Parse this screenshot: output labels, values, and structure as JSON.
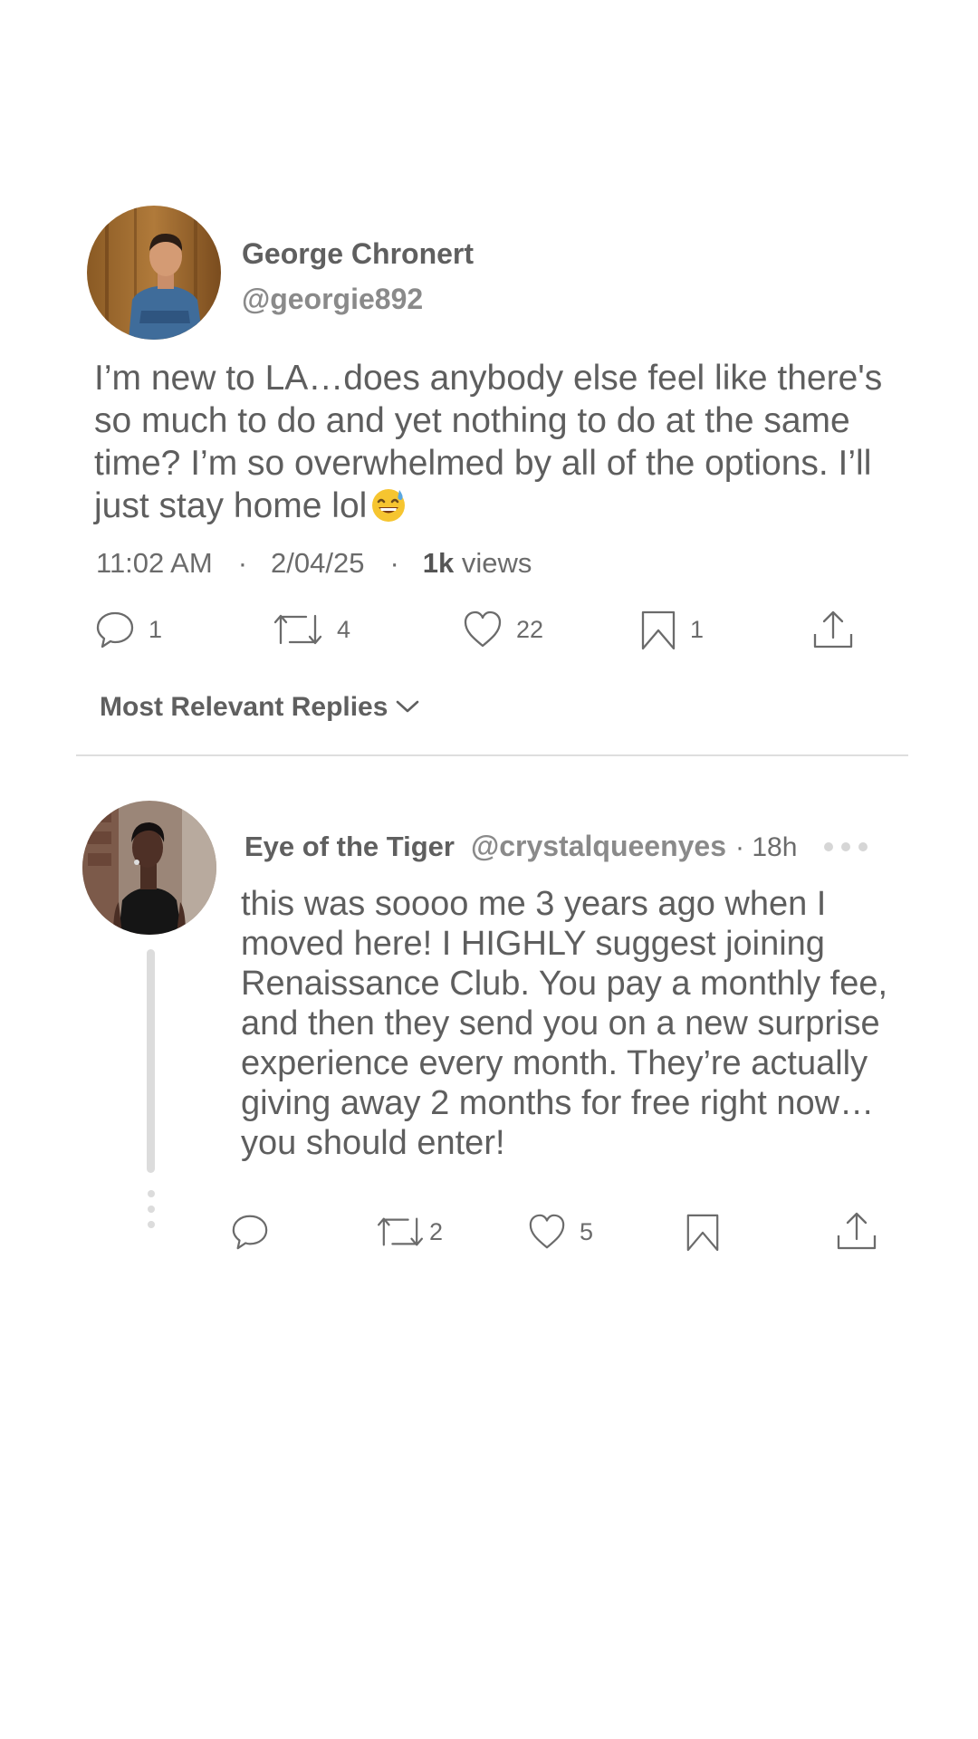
{
  "post": {
    "author_name": "George Chronert",
    "author_handle": "@georgie892",
    "avatar_icon": "user-avatar-photo",
    "text": "I’m new to LA…does anybody else feel like there's so much to do and yet nothing to do at the same time? I’m so overwhelmed by all of the options. I’ll just stay home lol",
    "emoji_icon": "grinning-sweat-emoji",
    "time": "11:02 AM",
    "date": "2/04/25",
    "separator": "·",
    "views_count": "1k",
    "views_label": "views",
    "actions": {
      "replies": "1",
      "reposts": "4",
      "likes": "22",
      "bookmarks": "1"
    }
  },
  "replies_sort": {
    "label": "Most Relevant Replies"
  },
  "reply": {
    "author_name": "Eye of the Tiger",
    "author_handle": "@crystalqueenyes",
    "time": "· 18h",
    "avatar_icon": "user-avatar-photo",
    "text": "this was soooo me 3 years ago when I moved here! I HIGHLY suggest joining Renaissance Club. You pay a monthly fee, and then they send you on a new surprise experience every month. They’re actually giving away 2 months for free right now… you should enter!",
    "actions": {
      "reposts": "2",
      "likes": "5"
    }
  },
  "colors": {
    "text": "#5e5e5e",
    "muted": "#8a8a8a",
    "divider": "#dedede",
    "icon_stroke": "#6b6b6b"
  }
}
